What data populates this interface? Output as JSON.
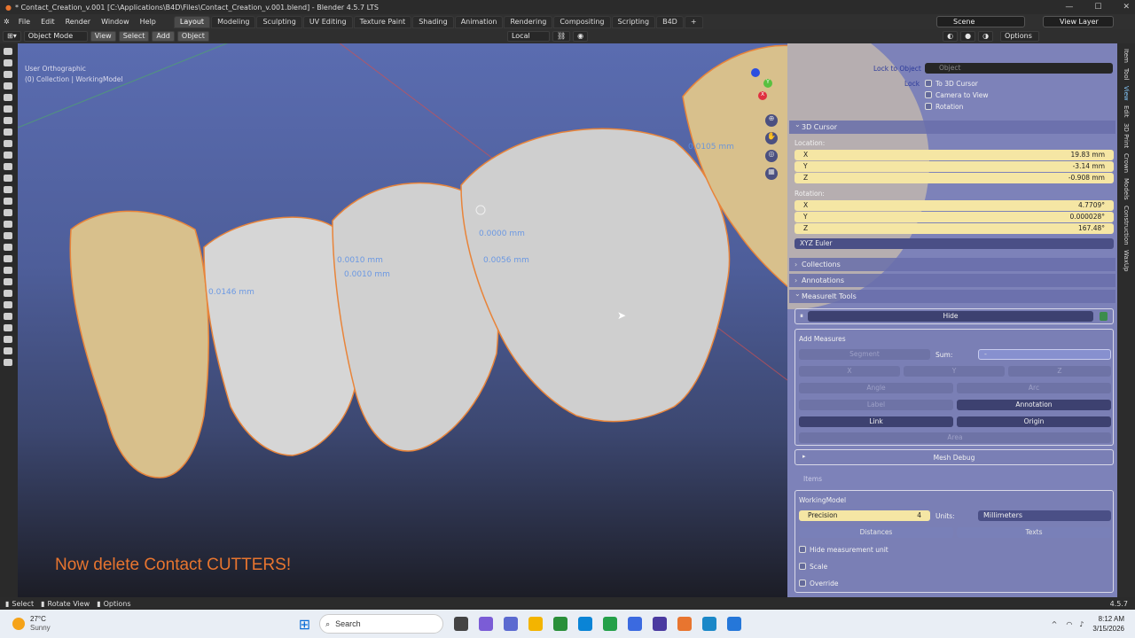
{
  "window": {
    "title": "* Contact_Creation_v.001 [C:\\Applications\\B4D\\Files\\Contact_Creation_v.001.blend] - Blender 4.5.7 LTS",
    "min": "—",
    "max": "☐",
    "close": "✕"
  },
  "menu": [
    "File",
    "Edit",
    "Render",
    "Window",
    "Help"
  ],
  "workspaces": [
    "Layout",
    "Modeling",
    "Sculpting",
    "UV Editing",
    "Texture Paint",
    "Shading",
    "Animation",
    "Rendering",
    "Compositing",
    "Scripting",
    "B4D",
    "+"
  ],
  "active_workspace": "Layout",
  "scene": {
    "name": "Scene",
    "view_layer": "View Layer"
  },
  "viewport_header": {
    "mode": "Object Mode",
    "view": "View",
    "select": "Select",
    "add": "Add",
    "object": "Object",
    "orientation": "Local",
    "options": "Options"
  },
  "viewport": {
    "view_name": "User Orthographic",
    "collection": "(0) Collection | WorkingModel",
    "caption": "Now delete Contact CUTTERS!",
    "measurements": [
      "0.0146 mm",
      "0.0010 mm",
      "0.0010 mm",
      "0.0000 mm",
      "0.0056 mm",
      "0.0105 mm"
    ]
  },
  "gizmo": {
    "x": "X",
    "y": "Y",
    "z": "Z"
  },
  "npanel": {
    "lock_to_object_label": "Lock to Object",
    "lock_object_placeholder": "Object",
    "lock_label": "Lock",
    "to_3d_cursor": "To 3D Cursor",
    "camera_to_view": "Camera to View",
    "rotation_chk": "Rotation",
    "cursor_section": "3D Cursor",
    "location_label": "Location:",
    "loc": [
      {
        "axis": "X",
        "value": "19.83 mm"
      },
      {
        "axis": "Y",
        "value": "-3.14 mm"
      },
      {
        "axis": "Z",
        "value": "-0.908 mm"
      }
    ],
    "rotation_label": "Rotation:",
    "rot": [
      {
        "axis": "X",
        "value": "4.7709°"
      },
      {
        "axis": "Y",
        "value": "0.000028°"
      },
      {
        "axis": "Z",
        "value": "167.48°"
      }
    ],
    "rot_mode": "XYZ Euler",
    "collections": "Collections",
    "annotations": "Annotations",
    "measureit": "MeasureIt Tools",
    "hide": "Hide",
    "add_measures": "Add Measures",
    "segment": "Segment",
    "sum": "Sum:",
    "sum_value": "-",
    "x": "X",
    "y": "Y",
    "z": "Z",
    "angle": "Angle",
    "arc": "Arc",
    "label": "Label",
    "annotation": "Annotation",
    "link": "Link",
    "origin": "Origin",
    "area": "Area",
    "mesh_debug": "Mesh Debug",
    "items": "Items",
    "working_model": "WorkingModel",
    "precision": "Precision",
    "precision_value": "4",
    "units_label": "Units:",
    "units_value": "Millimeters",
    "distances": "Distances",
    "texts": "Texts",
    "hide_unit": "Hide measurement unit",
    "scale": "Scale",
    "override": "Override"
  },
  "sidetabs": [
    "Item",
    "Tool",
    "View",
    "Edit",
    "3D Print",
    "Crown",
    "Models",
    "Construction",
    "WaxUp"
  ],
  "statusbar": {
    "select": "Select",
    "rotate": "Rotate View",
    "options": "Options",
    "version": "4.5.7"
  },
  "taskbar": {
    "temp": "27°C",
    "weather": "Sunny",
    "search": "Search",
    "time": "8:12 AM",
    "date": "3/15/2026"
  },
  "colors": {
    "accent": "#e8752f",
    "blender_blue": "#5a6cb0",
    "panel": "#7d82b9"
  }
}
